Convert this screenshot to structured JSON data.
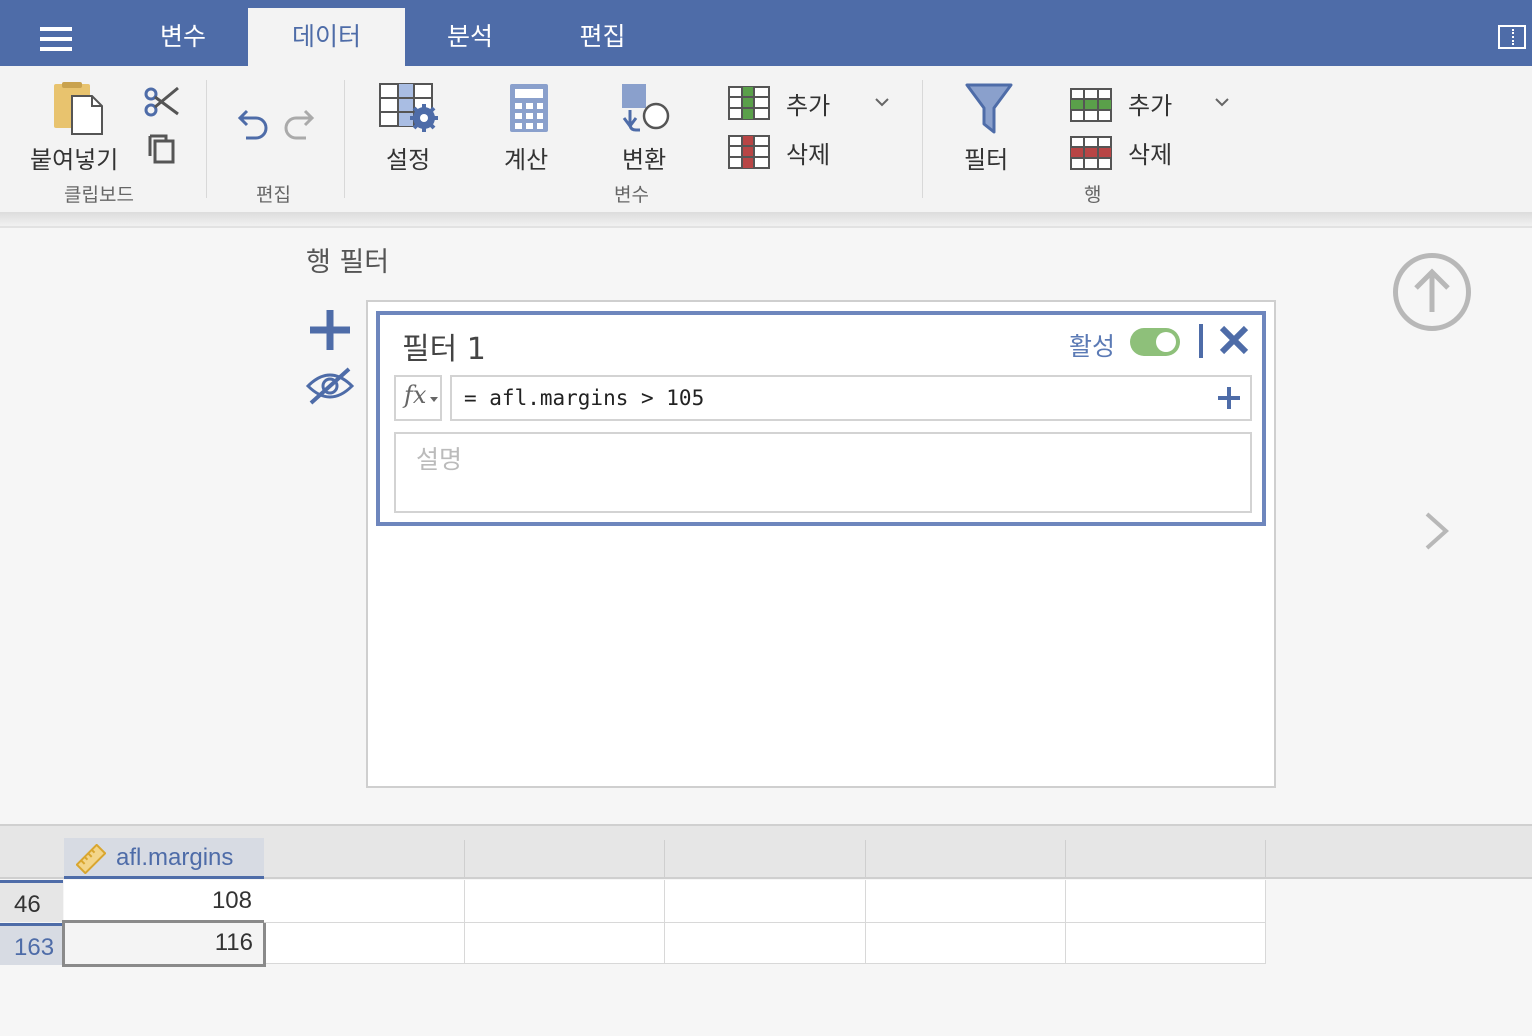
{
  "tabs": [
    {
      "label": "변수",
      "active": false
    },
    {
      "label": "데이터",
      "active": true
    },
    {
      "label": "분석",
      "active": false
    },
    {
      "label": "편집",
      "active": false
    }
  ],
  "ribbon": {
    "clipboard": {
      "paste_label": "붙여넣기",
      "group_label": "클립보드"
    },
    "edit": {
      "group_label": "편집"
    },
    "variables": {
      "setup_label": "설정",
      "compute_label": "계산",
      "transform_label": "변환",
      "add_label": "추가",
      "delete_label": "삭제",
      "group_label": "변수"
    },
    "rows": {
      "filter_label": "필터",
      "add_label": "추가",
      "delete_label": "삭제",
      "group_label": "행"
    }
  },
  "filter_panel": {
    "title": "행 필터",
    "filter": {
      "name": "필터 1",
      "active_label": "활성",
      "active": true,
      "fx_label": "fx",
      "formula": "= afl.margins > 105",
      "description_placeholder": "설명"
    }
  },
  "grid": {
    "column": {
      "name": "afl.margins",
      "icon": "ruler-icon"
    },
    "rows": [
      {
        "row_number": "46",
        "value": "108"
      },
      {
        "row_number": "163",
        "value": "116"
      }
    ]
  },
  "colors": {
    "accent": "#4e6ca8",
    "toggle_on": "#8ec07a",
    "paste_yellow": "#e8c36e",
    "add_green": "#5aa04a",
    "delete_red": "#b84545"
  }
}
